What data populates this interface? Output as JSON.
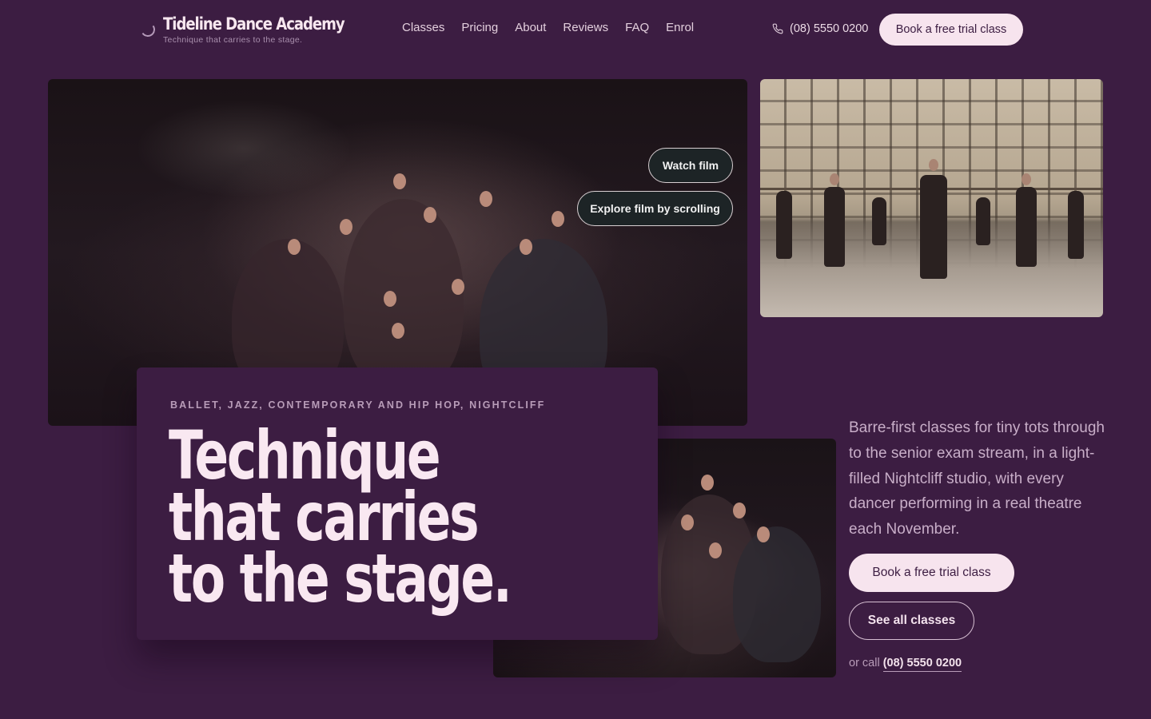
{
  "brand": {
    "name": "Tideline Dance Academy",
    "tagline": "Technique that carries to the stage."
  },
  "nav": {
    "items": [
      "Classes",
      "Pricing",
      "About",
      "Reviews",
      "FAQ",
      "Enrol"
    ]
  },
  "header": {
    "phone": "(08) 5550 0200",
    "cta_label": "Book a free trial class"
  },
  "hero": {
    "watch_film_label": "Watch film",
    "explore_film_label": "Explore film by scrolling"
  },
  "card": {
    "eyebrow": "BALLET, JAZZ, CONTEMPORARY AND HIP HOP, NIGHTCLIFF",
    "headline_lines": [
      "Technique",
      "that carries",
      "to the stage."
    ]
  },
  "intro": {
    "text": "Barre-first classes for tiny tots through to the senior exam stream, in a light-filled Nightcliff studio, with every dancer performing in a real theatre each November.",
    "cta_primary": "Book a free trial class",
    "cta_secondary": "See all classes",
    "call_prefix": "or call",
    "call_number": "(08) 5550 0200"
  },
  "colors": {
    "background": "#3c1d42",
    "accent_button": "#f7e4ee",
    "headline_text": "#f9e8f1"
  },
  "icons": {
    "logo": "crescent-logo-icon",
    "phone": "phone-icon"
  }
}
